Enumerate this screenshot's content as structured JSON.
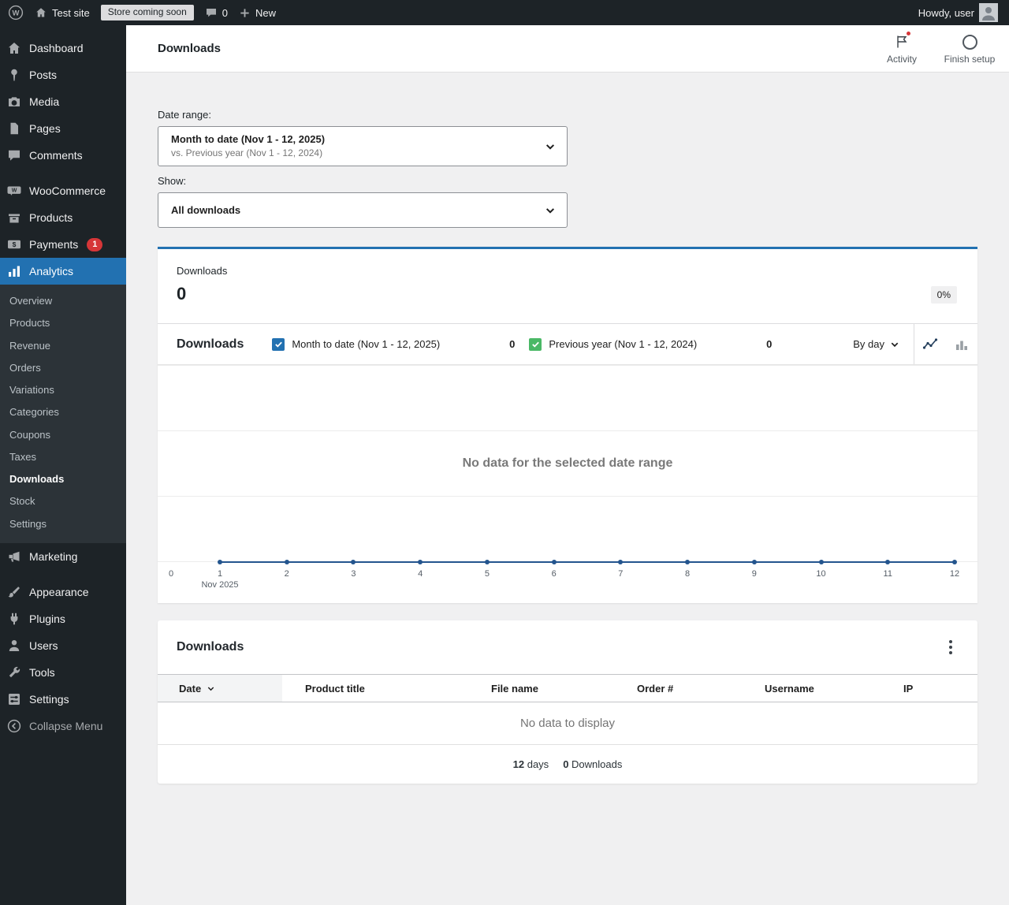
{
  "admin_bar": {
    "site_name": "Test site",
    "coming_soon_badge": "Store coming soon",
    "comments_count": "0",
    "new_label": "New",
    "howdy": "Howdy, user"
  },
  "sidebar": {
    "items": [
      {
        "label": "Dashboard"
      },
      {
        "label": "Posts"
      },
      {
        "label": "Media"
      },
      {
        "label": "Pages"
      },
      {
        "label": "Comments"
      },
      {
        "label": "WooCommerce"
      },
      {
        "label": "Products"
      },
      {
        "label": "Payments",
        "badge": "1"
      },
      {
        "label": "Analytics"
      },
      {
        "label": "Marketing"
      },
      {
        "label": "Appearance"
      },
      {
        "label": "Plugins"
      },
      {
        "label": "Users"
      },
      {
        "label": "Tools"
      },
      {
        "label": "Settings"
      },
      {
        "label": "Collapse Menu"
      }
    ],
    "analytics_submenu": [
      "Overview",
      "Products",
      "Revenue",
      "Orders",
      "Variations",
      "Categories",
      "Coupons",
      "Taxes",
      "Downloads",
      "Stock",
      "Settings"
    ],
    "current_submenu": "Downloads"
  },
  "header": {
    "title": "Downloads",
    "activity_label": "Activity",
    "finish_setup_label": "Finish setup"
  },
  "filters": {
    "date_range_label": "Date range:",
    "date_range_value": "Month to date (Nov 1 - 12, 2025)",
    "date_range_compare": "vs. Previous year (Nov 1 - 12, 2024)",
    "show_label": "Show:",
    "show_value": "All downloads"
  },
  "summary": {
    "label": "Downloads",
    "value": "0",
    "delta": "0%"
  },
  "chart": {
    "title": "Downloads",
    "series1_label": "Month to date (Nov 1 - 12, 2025)",
    "series1_value": "0",
    "series2_label": "Previous year (Nov 1 - 12, 2024)",
    "series2_value": "0",
    "interval_label": "By day",
    "empty_message": "No data for the selected date range",
    "y_zero": "0",
    "x_ticks": [
      "1",
      "2",
      "3",
      "4",
      "5",
      "6",
      "7",
      "8",
      "9",
      "10",
      "11",
      "12"
    ],
    "x_axis_month": "Nov 2025"
  },
  "chart_data": {
    "type": "line",
    "x": [
      1,
      2,
      3,
      4,
      5,
      6,
      7,
      8,
      9,
      10,
      11,
      12
    ],
    "xlabel": "Nov 2025",
    "ylabel": "Downloads",
    "ylim": [
      0,
      1
    ],
    "series": [
      {
        "name": "Month to date (Nov 1 - 12, 2025)",
        "values": [
          0,
          0,
          0,
          0,
          0,
          0,
          0,
          0,
          0,
          0,
          0,
          0
        ]
      },
      {
        "name": "Previous year (Nov 1 - 12, 2024)",
        "values": [
          0,
          0,
          0,
          0,
          0,
          0,
          0,
          0,
          0,
          0,
          0,
          0
        ]
      }
    ],
    "title": "Downloads",
    "empty_message": "No data for the selected date range",
    "legend_position": "top"
  },
  "table": {
    "title": "Downloads",
    "headers": [
      "Date",
      "Product title",
      "File name",
      "Order #",
      "Username",
      "IP"
    ],
    "rows": [],
    "empty_message": "No data to display",
    "summary_days_value": "12",
    "summary_days_label": "days",
    "summary_downloads_value": "0",
    "summary_downloads_label": "Downloads"
  },
  "colors": {
    "accent": "#2271b1",
    "series1_checkbox": "#2271b1",
    "series2_checkbox": "#4ab866",
    "chart_line": "#24558e",
    "badge_red": "#d63638",
    "sidebar_bg": "#1d2327",
    "submenu_bg": "#2c3338",
    "page_bg": "#f0f0f1"
  }
}
